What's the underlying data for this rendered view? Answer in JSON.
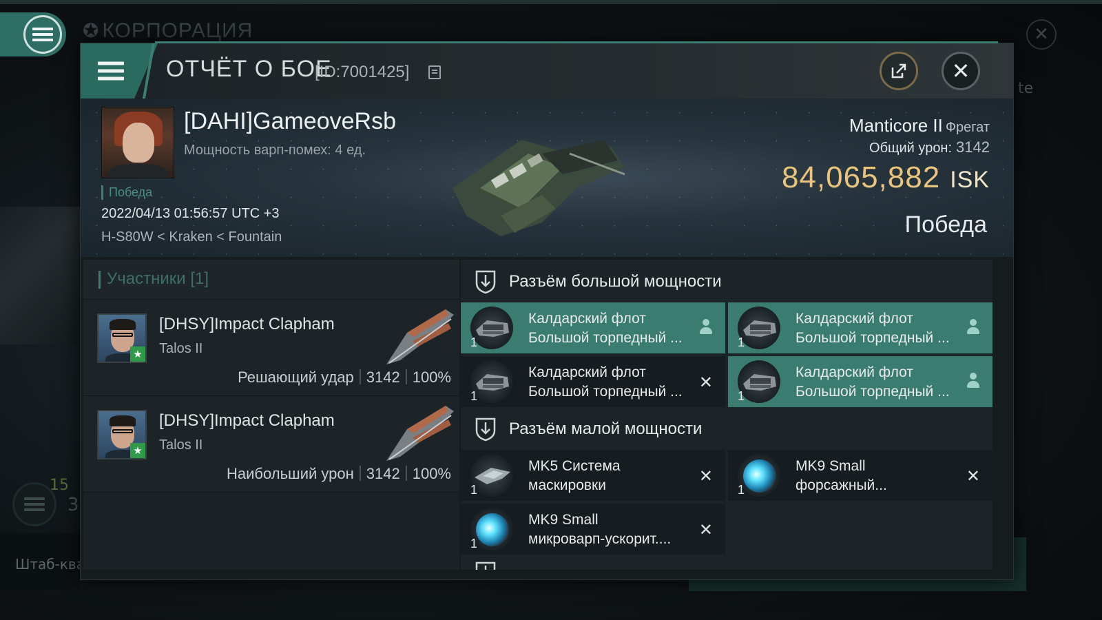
{
  "background": {
    "title": "КОРПОРАЦИЯ",
    "right_text": "te",
    "counter_top": "15",
    "counter_bottom": "3",
    "left_footer": "Штаб-ква"
  },
  "dialog": {
    "title": "ОТЧЁТ О БОЕ",
    "id_label": "[ID:7001425]"
  },
  "victim": {
    "name": "[DAHI]GameoveRsb",
    "warp_disruption": "Мощность варп-помех: 4 ед.",
    "status": "Победа",
    "datetime": "2022/04/13 01:56:57 UTC +3",
    "location": "H-S80W < Kraken < Fountain",
    "ship": "Manticore II",
    "ship_class": "Фрегат",
    "total_damage_label": "Общий урон:",
    "total_damage": "3142",
    "isk_value": "84,065,882",
    "isk_unit": "ISK",
    "result": "Победа"
  },
  "participants": {
    "header": "Участники [1]",
    "rows": [
      {
        "name": "[DHSY]Impact Clapham",
        "ship": "Talos II",
        "role": "Решающий удар",
        "damage": "3142",
        "percent": "100%"
      },
      {
        "name": "[DHSY]Impact Clapham",
        "ship": "Talos II",
        "role": "Наибольший урон",
        "damage": "3142",
        "percent": "100%"
      }
    ]
  },
  "modules": {
    "high_slot_title": "Разъём большой мощности",
    "mid_slot_title": "Разъём малой мощности",
    "high": [
      {
        "line1": "Калдарский флот",
        "line2": "Большой торпедный ...",
        "qty": "1",
        "state": "dropped"
      },
      {
        "line1": "Калдарский флот",
        "line2": "Большой торпедный ...",
        "qty": "1",
        "state": "dropped"
      },
      {
        "line1": "Калдарский флот",
        "line2": "Большой торпедный ...",
        "qty": "1",
        "state": "destroyed"
      },
      {
        "line1": "Калдарский флот",
        "line2": "Большой торпедный ...",
        "qty": "1",
        "state": "dropped"
      }
    ],
    "mid": [
      {
        "line1": "MK5 Система",
        "line2": "маскировки",
        "qty": "1",
        "state": "destroyed"
      },
      {
        "line1": "MK9 Small",
        "line2": "форсажный...",
        "qty": "1",
        "state": "destroyed"
      },
      {
        "line1": "MK9 Small",
        "line2": "микроварп-ускорит....",
        "qty": "1",
        "state": "destroyed"
      }
    ],
    "destroyed_mark": "✕"
  },
  "colors": {
    "accent": "#3e7e72",
    "loot_slot": "#3a7d70",
    "isk": "#e9c47c",
    "panel": "#1d2427"
  }
}
